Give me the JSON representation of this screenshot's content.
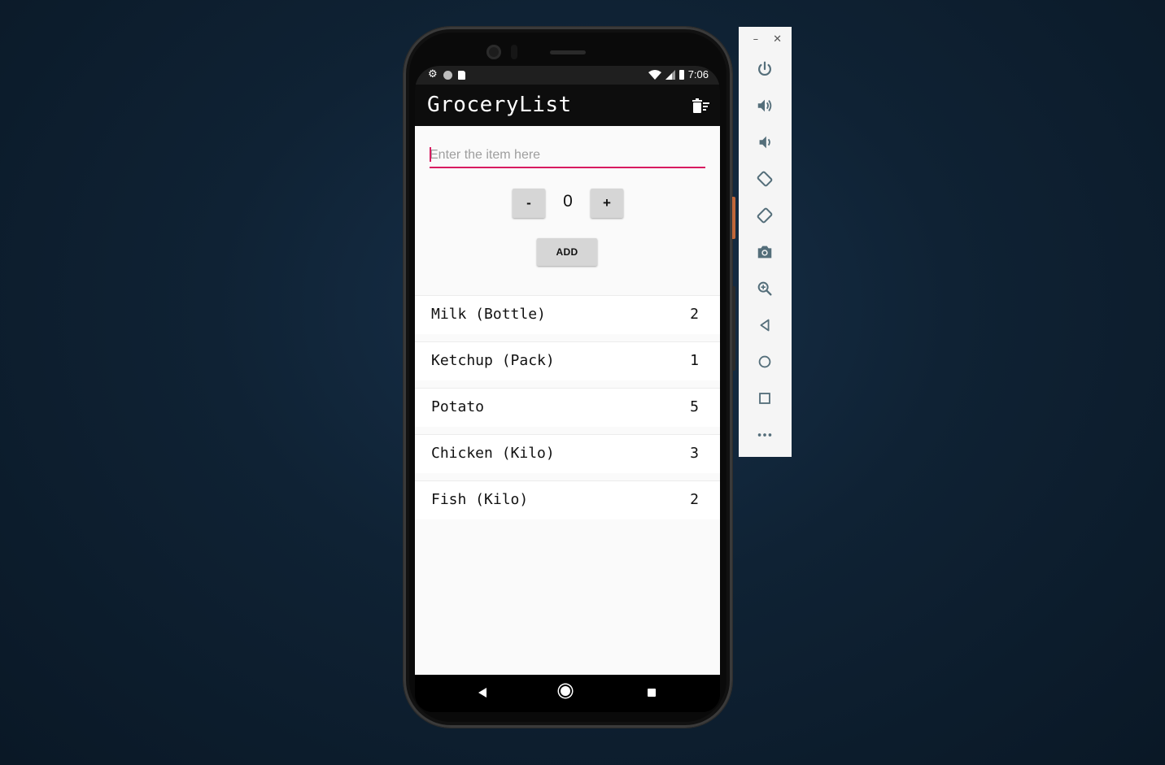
{
  "status_bar": {
    "time": "7:06",
    "left_icons": [
      "settings-icon",
      "circle-icon",
      "sd-card-icon"
    ],
    "right_icons": [
      "wifi-icon",
      "signal-icon",
      "battery-icon"
    ]
  },
  "app_bar": {
    "title": "GroceryList",
    "action_icon": "delete-sweep-icon"
  },
  "form": {
    "item_placeholder": "Enter the item here",
    "item_value": "",
    "minus_label": "-",
    "plus_label": "+",
    "quantity": "0",
    "add_label": "ADD"
  },
  "items": [
    {
      "name": "Milk (Bottle)",
      "count": "2"
    },
    {
      "name": "Ketchup (Pack)",
      "count": "1"
    },
    {
      "name": "Potato",
      "count": "5"
    },
    {
      "name": "Chicken (Kilo)",
      "count": "3"
    },
    {
      "name": "Fish (Kilo)",
      "count": "2"
    }
  ],
  "nav_bar": {
    "icons": [
      "back-icon",
      "home-icon",
      "recents-icon"
    ]
  },
  "emulator_toolbar": {
    "window_controls": [
      "minimize-icon",
      "close-icon"
    ],
    "buttons": [
      "power-icon",
      "volume-up-icon",
      "volume-down-icon",
      "rotate-left-icon",
      "rotate-right-icon",
      "camera-icon",
      "zoom-icon",
      "back-icon",
      "home-icon",
      "overview-icon",
      "more-icon"
    ]
  },
  "colors": {
    "accent": "#d81b60",
    "app_bar": "#0d0d0d",
    "background": "#fafafa",
    "button": "#d6d6d6"
  }
}
